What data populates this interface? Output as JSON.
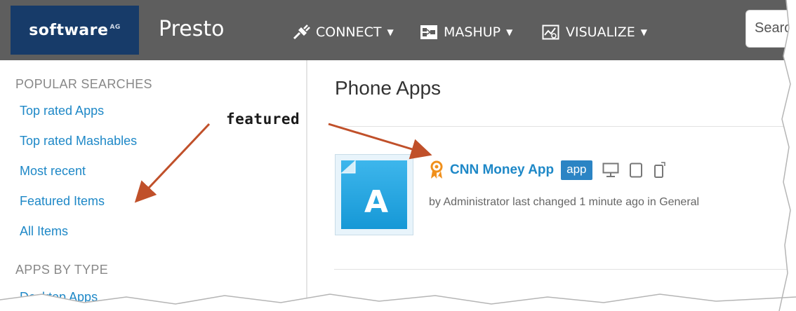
{
  "header": {
    "logo_text": "software",
    "logo_suffix": "AG",
    "app_name": "Presto",
    "nav": [
      {
        "label": "CONNECT",
        "icon": "plug-icon"
      },
      {
        "label": "MASHUP",
        "icon": "mashup-icon"
      },
      {
        "label": "VISUALIZE",
        "icon": "chart-icon"
      }
    ],
    "search_placeholder": "Search"
  },
  "sidebar": {
    "popular_title": "POPULAR SEARCHES",
    "popular_links": [
      "Top rated Apps",
      "Top rated Mashables",
      "Most recent",
      "Featured Items",
      "All Items"
    ],
    "apps_by_type_title": "APPS BY TYPE",
    "apps_by_type_links": [
      "Desktop Apps"
    ]
  },
  "main": {
    "title": "Phone Apps",
    "item": {
      "name": "CNN Money App",
      "badge": "app",
      "meta": "by Administrator last changed 1 minute ago in General",
      "thumbnail_letter": "A"
    }
  },
  "annotation": {
    "text": "featured"
  },
  "colors": {
    "topbar": "#5e5e5e",
    "logo": "#173b69",
    "link": "#1e88c7",
    "badge": "#2b84c4",
    "arrow": "#c0502a",
    "featured": "#f0901c"
  }
}
